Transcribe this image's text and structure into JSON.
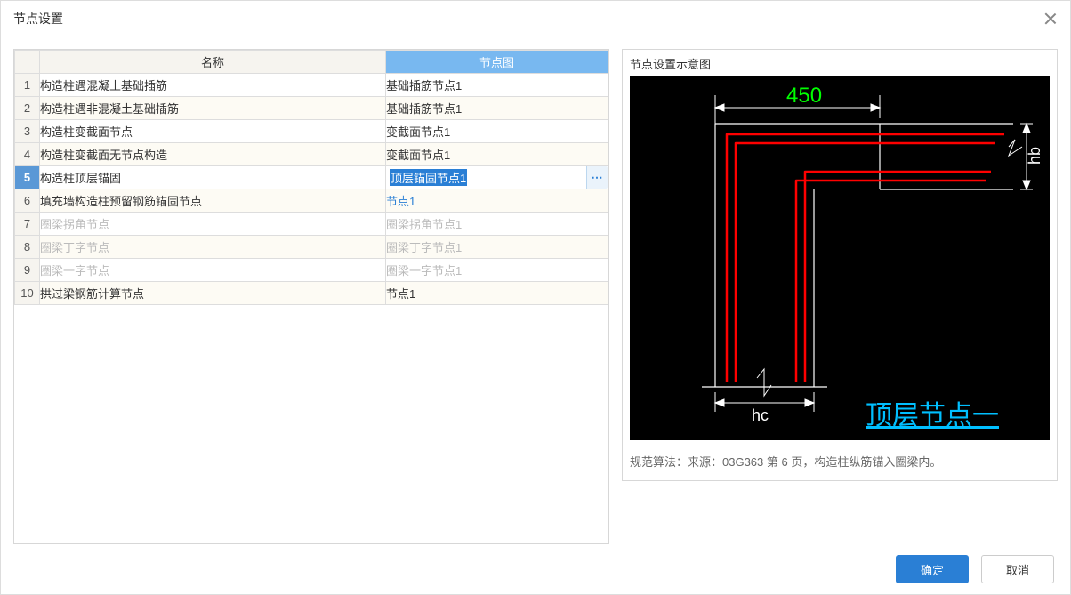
{
  "dialog": {
    "title": "节点设置"
  },
  "table": {
    "headers": {
      "name": "名称",
      "node": "节点图"
    },
    "rows": [
      {
        "num": "1",
        "name": "构造柱遇混凝土基础插筋",
        "node": "基础插筋节点1",
        "alt": false,
        "disabled": false,
        "link": false,
        "editing": false
      },
      {
        "num": "2",
        "name": "构造柱遇非混凝土基础插筋",
        "node": "基础插筋节点1",
        "alt": true,
        "disabled": false,
        "link": false,
        "editing": false
      },
      {
        "num": "3",
        "name": "构造柱变截面节点",
        "node": "变截面节点1",
        "alt": false,
        "disabled": false,
        "link": false,
        "editing": false
      },
      {
        "num": "4",
        "name": "构造柱变截面无节点构造",
        "node": "变截面节点1",
        "alt": true,
        "disabled": false,
        "link": false,
        "editing": false
      },
      {
        "num": "5",
        "name": "构造柱顶层锚固",
        "node": "顶层锚固节点1",
        "alt": false,
        "disabled": false,
        "link": false,
        "editing": true
      },
      {
        "num": "6",
        "name": "填充墙构造柱预留钢筋锚固节点",
        "node": "节点1",
        "alt": true,
        "disabled": false,
        "link": true,
        "editing": false
      },
      {
        "num": "7",
        "name": "圈梁拐角节点",
        "node": "圈梁拐角节点1",
        "alt": false,
        "disabled": true,
        "link": false,
        "editing": false
      },
      {
        "num": "8",
        "name": "圈梁丁字节点",
        "node": "圈梁丁字节点1",
        "alt": true,
        "disabled": true,
        "link": false,
        "editing": false
      },
      {
        "num": "9",
        "name": "圈梁一字节点",
        "node": "圈梁一字节点1",
        "alt": false,
        "disabled": true,
        "link": false,
        "editing": false
      },
      {
        "num": "10",
        "name": "拱过梁钢筋计算节点",
        "node": "节点1",
        "alt": true,
        "disabled": false,
        "link": false,
        "editing": false
      }
    ]
  },
  "preview": {
    "title": "节点设置示意图",
    "dim_top": "450",
    "dim_right": "hb",
    "dim_bottom": "hc",
    "caption": "顶层节点一",
    "source": "规范算法：来源：03G363 第 6 页，构造柱纵筋锚入圈梁内。"
  },
  "footer": {
    "ok": "确定",
    "cancel": "取消"
  },
  "ellipsis": "⋯"
}
